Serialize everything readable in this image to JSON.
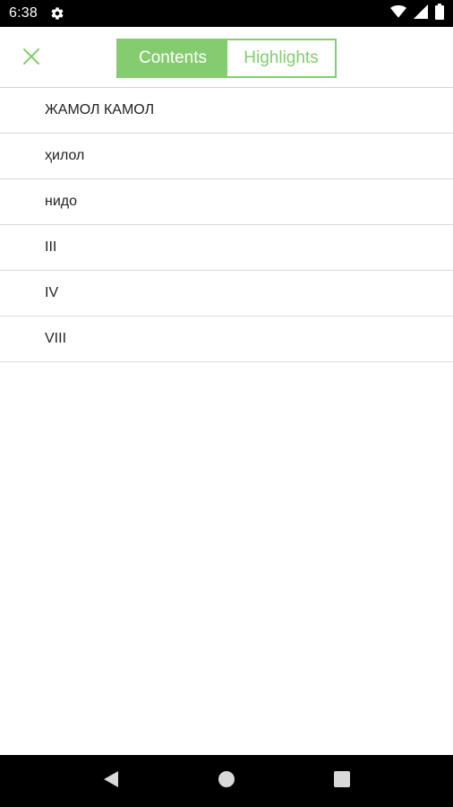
{
  "status_bar": {
    "time": "6:38",
    "icons": [
      "gear-icon",
      "wifi-icon",
      "cell-signal-icon",
      "battery-icon"
    ]
  },
  "toolbar": {
    "close_icon": "close-icon",
    "accent_color": "#84cc6f",
    "tabs": [
      {
        "label": "Contents",
        "selected": true
      },
      {
        "label": "Highlights",
        "selected": false
      }
    ]
  },
  "toc": {
    "items": [
      {
        "label": "ЖАМОЛ КАМОЛ"
      },
      {
        "label": "ҳилол"
      },
      {
        "label": "нидо"
      },
      {
        "label": "III"
      },
      {
        "label": "IV"
      },
      {
        "label": "VIII"
      }
    ]
  },
  "nav_bar": {
    "icons": [
      "back-icon",
      "home-icon",
      "recents-icon"
    ]
  }
}
